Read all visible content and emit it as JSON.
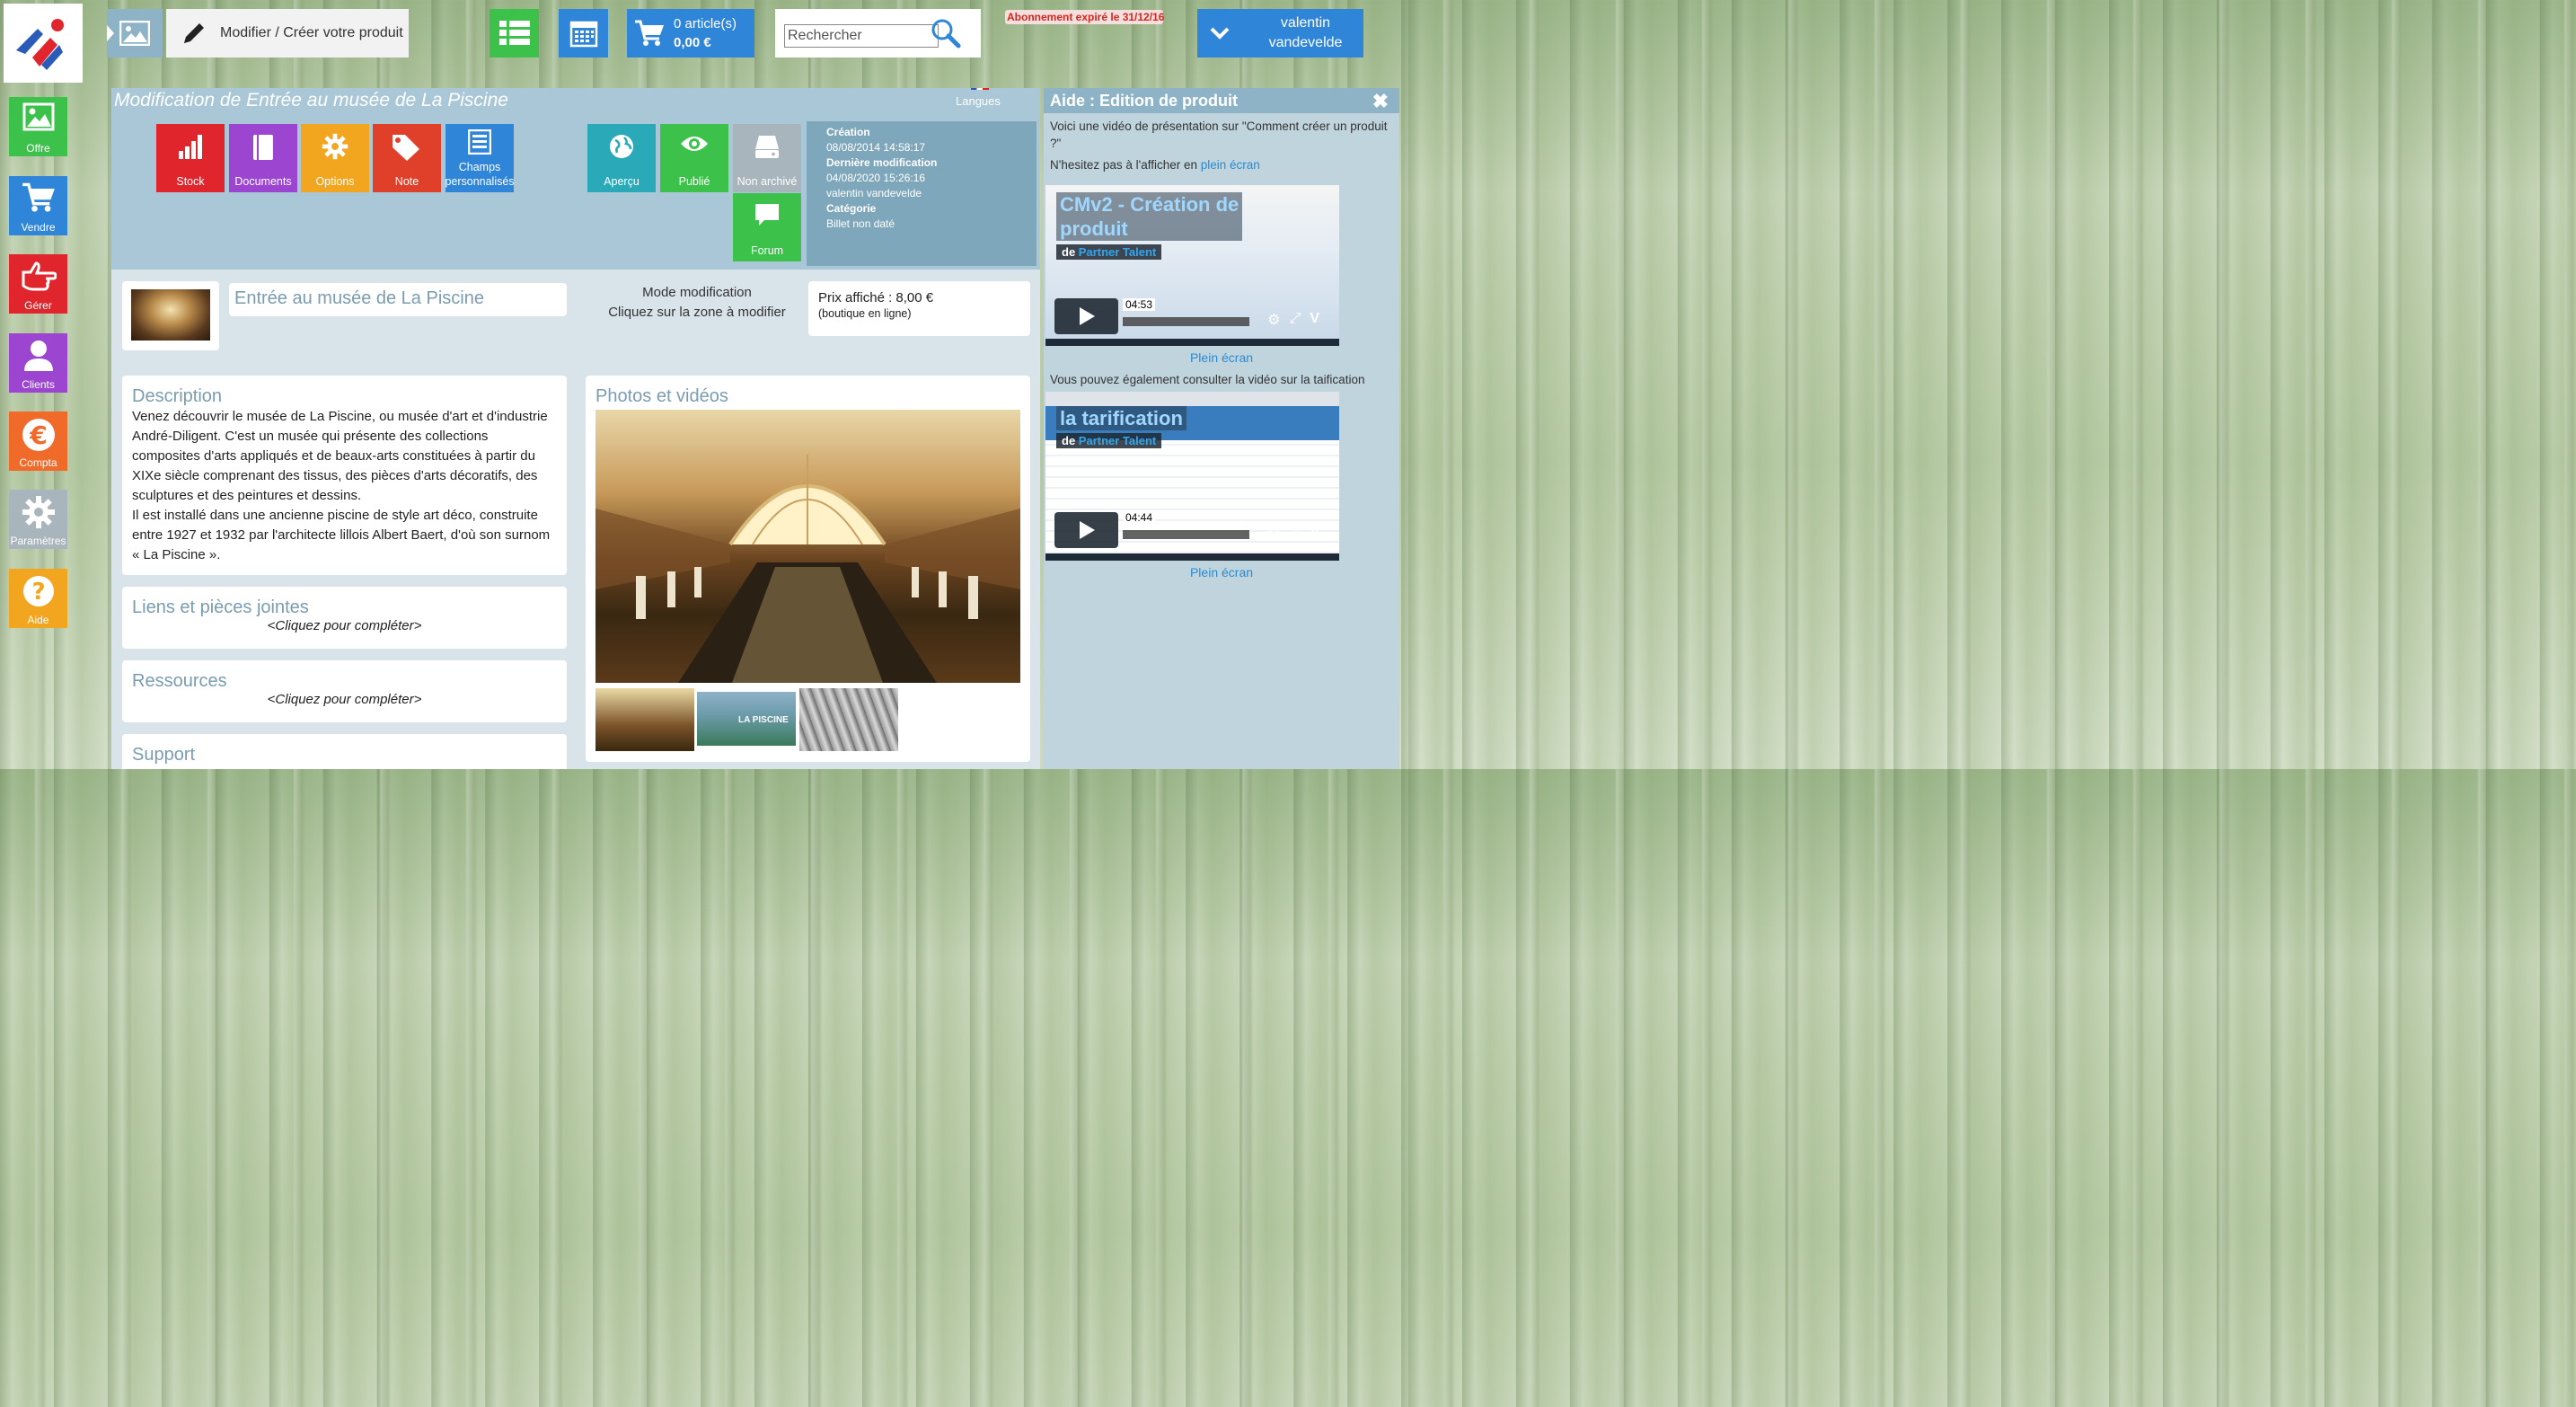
{
  "toolbar": {
    "edit_label": "Modifier / Créer votre produit",
    "cart_count": "0 article(s)",
    "cart_total": "0,00 €",
    "search_placeholder": "Rechercher",
    "subscription_notice": "Abonnement expiré le 31/12/16",
    "user_name": "valentin\nvandevelde"
  },
  "sidebar": {
    "items": [
      {
        "label": "Offre",
        "icon": "image-icon",
        "color": "#3cc24a"
      },
      {
        "label": "Vendre",
        "icon": "cart-icon",
        "color": "#2f85d8"
      },
      {
        "label": "Gérer",
        "icon": "hand-pointer-icon",
        "color": "#e0262c"
      },
      {
        "label": "Clients",
        "icon": "user-icon",
        "color": "#9b45d0"
      },
      {
        "label": "Compta",
        "icon": "euro-icon",
        "color": "#f06a2a"
      },
      {
        "label": "Paramètres",
        "icon": "gear-icon",
        "color": "#a9b5bc"
      },
      {
        "label": "Aide",
        "icon": "question-icon",
        "color": "#f2a51f"
      }
    ]
  },
  "product": {
    "page_title": "Modification de Entrée au musée de La Piscine",
    "languages_label": "Langues",
    "actions": [
      {
        "label": "Stock",
        "icon": "bar-chart-icon",
        "color": "#e0262c"
      },
      {
        "label": "Documents",
        "icon": "book-icon",
        "color": "#9b45d0"
      },
      {
        "label": "Options",
        "icon": "gear-icon",
        "color": "#f2a51f"
      },
      {
        "label": "Note",
        "icon": "tag-icon",
        "color": "#e0402a"
      },
      {
        "label": "Champs\npersonnalisés",
        "icon": "form-icon",
        "color": "#2f85d8"
      },
      {
        "label": "Aperçu",
        "icon": "globe-icon",
        "color": "#2aa9b8"
      },
      {
        "label": "Publié",
        "icon": "eye-icon",
        "color": "#3cc24a"
      },
      {
        "label": "Non archivé",
        "icon": "drive-icon",
        "color": "#a9b5bc"
      },
      {
        "label": "Forum",
        "icon": "chat-icon",
        "color": "#3cc24a"
      }
    ],
    "meta": {
      "creation_label": "Création",
      "creation_value": "08/08/2014 14:58:17",
      "modified_label": "Dernière modification",
      "modified_value": "04/08/2020 15:26:16",
      "modified_by": "valentin vandevelde",
      "category_label": "Catégorie",
      "category_value": "Billet non daté"
    },
    "name": "Entrée au musée de La Piscine",
    "mode_line1": "Mode modification",
    "mode_line2": "Cliquez sur la zone à modifier",
    "price_line": "Prix affiché : 8,00 €",
    "price_note": "(boutique en ligne)",
    "description_title": "Description",
    "description_text": "Venez découvrir le musée de La Piscine, ou musée d'art et d'industrie André-Diligent. C'est un musée qui présente des collections composites d'arts appliqués et de beaux-arts constituées à partir du XIXe siècle comprenant des tissus, des pièces d'arts décoratifs, des sculptures et des peintures et dessins.\nIl est installé dans une ancienne piscine de style art déco, construite entre 1927 et 1932 par l'architecte lillois Albert Baert, d'où son surnom « La Piscine ».",
    "links_title": "Liens et pièces jointes",
    "links_placeholder": "<Cliquez pour compléter>",
    "resources_title": "Ressources",
    "resources_placeholder": "<Cliquez pour compléter>",
    "support_title": "Support",
    "photos_title": "Photos et vidéos",
    "thumb2_caption": "LA PISCINE"
  },
  "help": {
    "title": "Aide : Edition de produit",
    "intro": "Voici une vidéo de présentation sur \"Comment créer un produit ?\"",
    "hint_prefix": "N'hesitez pas à l'afficher en ",
    "hint_link": "plein écran",
    "video1_title": "CMv2 - Création de\nproduit",
    "video1_by_prefix": "de ",
    "video1_author": "Partner Talent",
    "video1_time": "04:53",
    "fullscreen1": "Plein écran",
    "also_text": "Vous pouvez également consulter la vidéo sur la taification",
    "video2_title": "la tarification",
    "video2_by_prefix": "de ",
    "video2_author": "Partner Talent",
    "video2_time": "04:44",
    "fullscreen2": "Plein écran"
  }
}
